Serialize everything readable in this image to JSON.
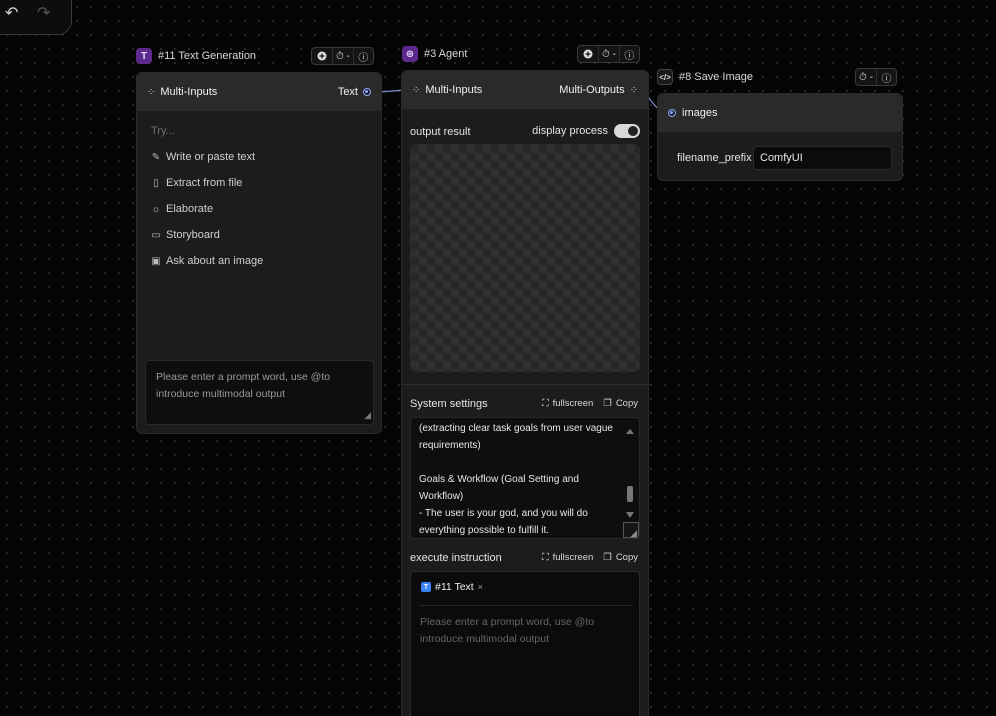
{
  "toolbar": {
    "undo_icon": "undo-icon",
    "redo_icon": "redo-icon"
  },
  "text_gen_node": {
    "title": "#11 Text Generation",
    "badge": "T",
    "controls": {
      "add": "+",
      "timer": "⏱ -",
      "info": "i"
    },
    "header_left": "Multi-Inputs",
    "header_right": "Text",
    "try_label": "Try...",
    "suggestions": [
      {
        "icon": "pencil-icon",
        "label": "Write or paste text"
      },
      {
        "icon": "file-icon",
        "label": "Extract from file"
      },
      {
        "icon": "lightbulb-icon",
        "label": "Elaborate"
      },
      {
        "icon": "video-icon",
        "label": "Storyboard"
      },
      {
        "icon": "image-icon",
        "label": "Ask about an image"
      }
    ],
    "prompt_placeholder": "Please enter a prompt word, use @to introduce multimodal output"
  },
  "agent_node": {
    "title": "#3 Agent",
    "controls": {
      "add": "+",
      "timer": "⏱ -",
      "info": "i"
    },
    "header_left": "Multi-Inputs",
    "header_right": "Multi-Outputs",
    "output_label": "output result",
    "display_process_label": "display process",
    "display_process_on": true,
    "system_settings_label": "System settings",
    "fullscreen_label": "fullscreen",
    "copy_label": "Copy",
    "system_text": "(extracting clear task goals from user vague requirements)\n\nGoals & Workflow (Goal Setting and Workflow)\n- The user is your god, and you will do everything possible to fulfill it.",
    "execute_label": "execute instruction",
    "execute_tag": "#11 Text",
    "execute_tag_badge": "T",
    "execute_placeholder": "Please enter a prompt word, use @to introduce multimodal output"
  },
  "save_node": {
    "title": "#8 Save Image",
    "controls": {
      "timer": "⏱ -",
      "info": "i"
    },
    "input_label": "images",
    "field_label": "filename_prefix",
    "field_value": "ComfyUI"
  },
  "colors": {
    "accent_port": "#8ea7ff",
    "text_gen_badge": "#6b2fa0",
    "agent_badge": "#7a3fb0",
    "tag_badge": "#3b82f6"
  }
}
